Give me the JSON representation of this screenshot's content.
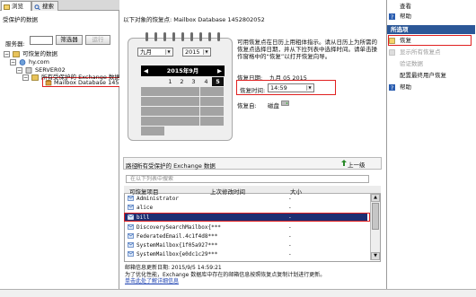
{
  "tabs": [
    {
      "label": "浏览"
    },
    {
      "label": "搜索"
    }
  ],
  "left": {
    "title": "受保护的数据",
    "server_label": "服务器:",
    "filter_btn": "筛选器",
    "go_btn": "运行",
    "tree": [
      {
        "label": "可恢复的数据"
      },
      {
        "label": "hy.com"
      },
      {
        "label": "SERVER02"
      },
      {
        "label": "所有受保护的 Exchange 数据"
      },
      {
        "label": "Mailbox Database 1452802"
      }
    ]
  },
  "center": {
    "db_header": "以下对象的恢复点:     Mailbox Database 1452802052",
    "month": "九月",
    "year": "2015",
    "cal_title": "2015年9月",
    "cal_days": [
      "1",
      "2",
      "3",
      "4",
      "5"
    ],
    "restore_info": "可用恢复点在日历上用粗体指示。请从日历上为所需的恢复点选择日期，并从下拉列表中选择时间。请单击操作窗格中的“恢复”以打开恢复向导。",
    "date_label": "恢复日期:",
    "date_value": "九月 05 2015",
    "time_label": "恢复时间:",
    "time_value": "14:59",
    "loc_label": "恢复自:",
    "loc_value": "磁盘",
    "path_label": "路径:",
    "path_value": "所有受保护的 Exchange 数据",
    "up_btn": "上一级",
    "search_placeholder": "在以下列表中搜索",
    "columns": [
      "可恢复项目",
      "上次修改时间",
      "大小"
    ],
    "rows": [
      {
        "name": "Administrator",
        "date": "-"
      },
      {
        "name": "alice",
        "date": "-"
      },
      {
        "name": "bill",
        "date": "-"
      },
      {
        "name": "DiscoverySearchMailbox{***",
        "date": "-"
      },
      {
        "name": "FederatedEmail.4c1f4d8***",
        "date": "-"
      },
      {
        "name": "SystemMailbox{1f05a927***",
        "date": "-"
      },
      {
        "name": "SystemMailbox{e0dc1c29***",
        "date": "-"
      }
    ],
    "footer_line1": "邮箱信息更新日期: 2015/9/5 14:59:21",
    "footer_line2": "为了优化性能，Exchange 数据库中存在的邮箱信息按照恢复点复制计划进行更新。",
    "footer_link": "单击此处了解详细信息"
  },
  "right": {
    "items_top": [
      {
        "label": "查看"
      },
      {
        "label": "帮助"
      }
    ],
    "section": "所选项",
    "items": [
      {
        "label": "恢复",
        "enabled": true
      },
      {
        "label": "显示所有恢复点",
        "enabled": false
      },
      {
        "label": "验证数据",
        "enabled": false
      },
      {
        "label": "配置最终用户恢复",
        "enabled": true
      },
      {
        "label": "帮助",
        "enabled": true
      }
    ]
  }
}
